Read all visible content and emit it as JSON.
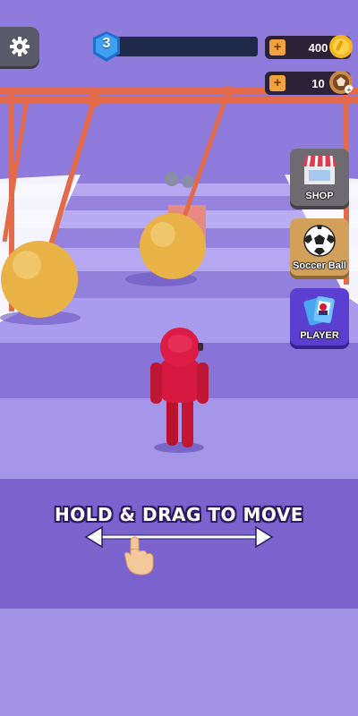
{
  "hud": {
    "level": "3",
    "level_progress": 0.0,
    "coins": "400",
    "balls": "10",
    "plus_symbol": "+"
  },
  "side_menu": {
    "shop_label": "SHOP",
    "soccer_ball_label": "Soccer Ball",
    "player_label": "PLAYER"
  },
  "tutorial": {
    "hint_text": "HOLD & DRAG TO MOVE"
  },
  "icons": {
    "settings": "gear-icon",
    "level": "shield-icon",
    "coin": "coin-icon",
    "ball": "ball-icon",
    "shop": "shop-stand-icon",
    "soccer": "soccer-ball-icon",
    "player": "cards-icon",
    "drag": "double-arrow-icon",
    "hand": "pointing-hand-icon"
  },
  "colors": {
    "player": "#d4183e",
    "wrecking_ball": "#e8b246",
    "rail": "#e36a4a",
    "track_light": "#a99cec",
    "track_dark": "#7258c6"
  }
}
